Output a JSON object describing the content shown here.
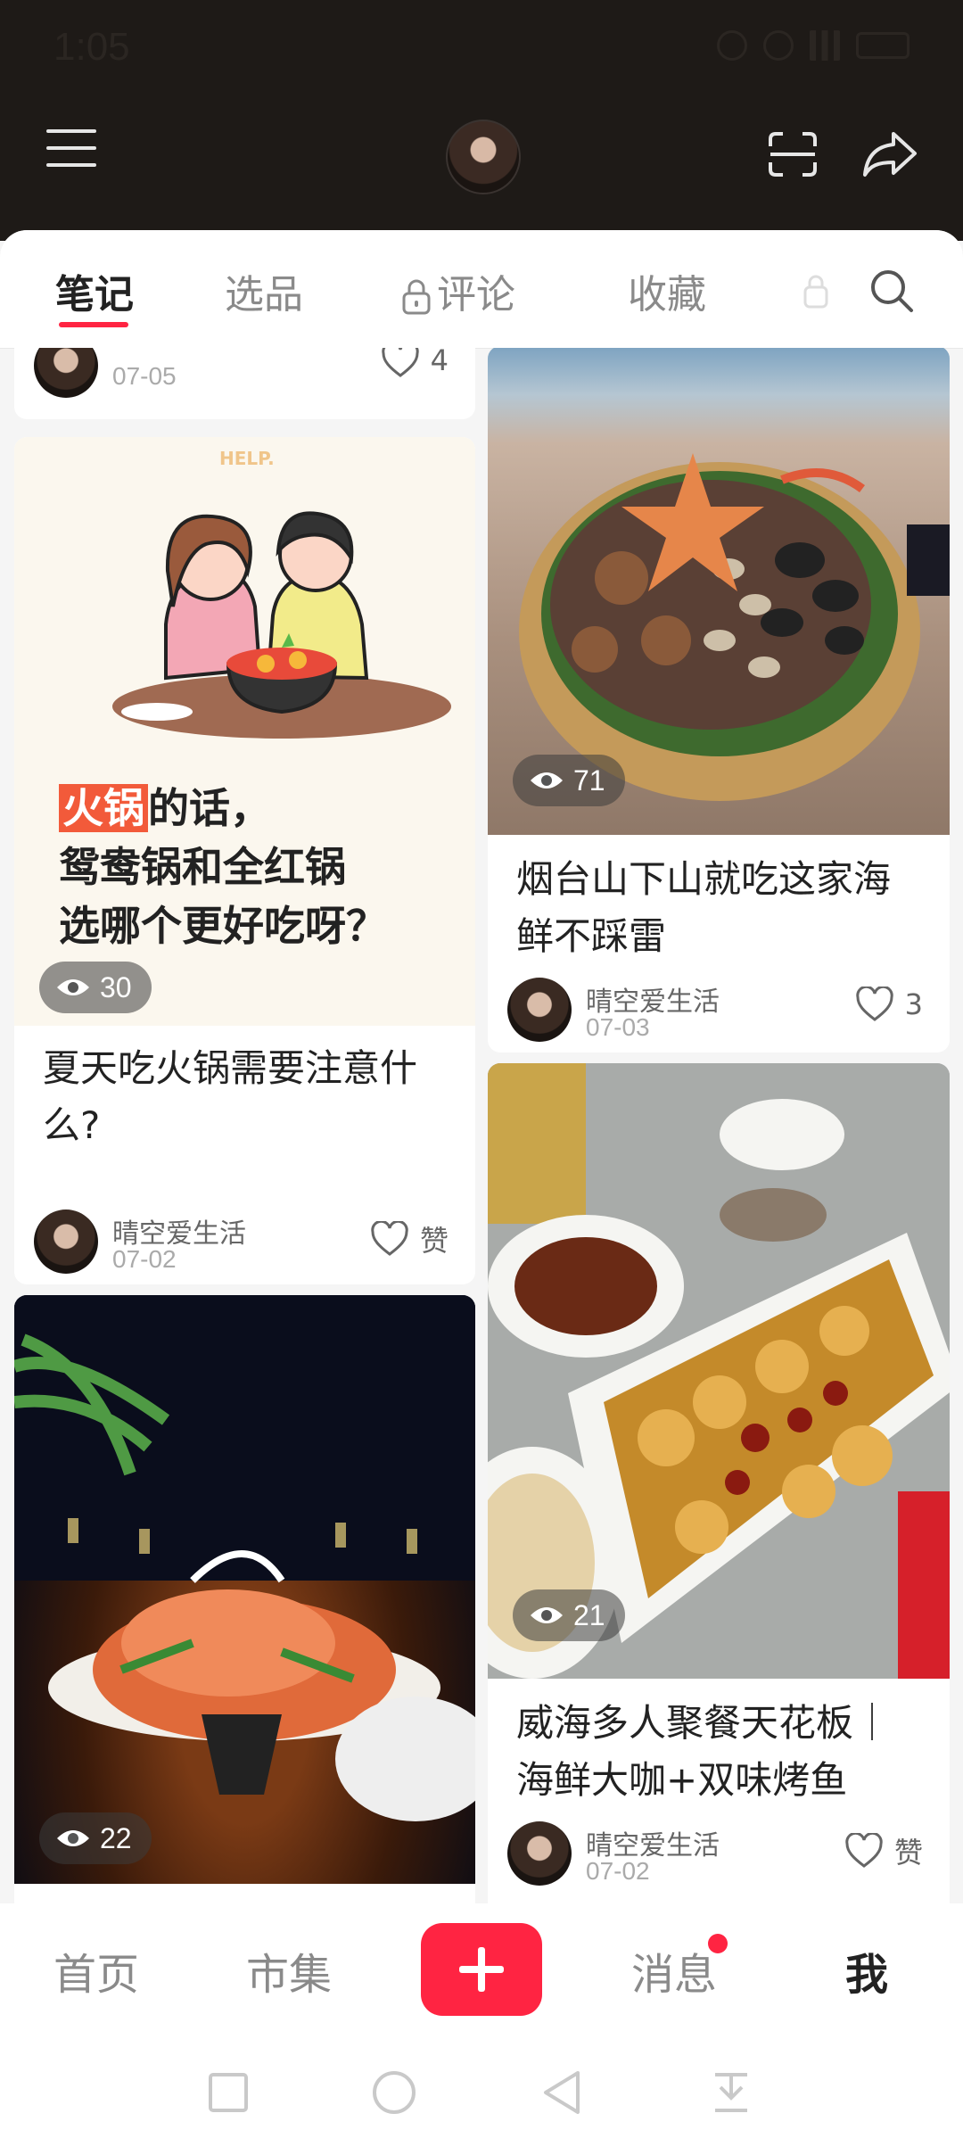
{
  "status_bar": {
    "time": "1:05"
  },
  "tabs": [
    {
      "label": "笔记",
      "active": true
    },
    {
      "label": "选品"
    },
    {
      "label": "评论",
      "locked": true
    },
    {
      "label": "收藏"
    }
  ],
  "colors": {
    "accent": "#ff2442",
    "header_bg": "#1e1a17"
  },
  "feed": {
    "top_partial": {
      "author": "晴空爱生活",
      "date": "07-05",
      "likes": "4"
    },
    "card1": {
      "overlay_lines": [
        "火锅的话，",
        "鸳鸯锅和全红锅",
        "选哪个更好吃呀？"
      ],
      "overlay_highlight": "火锅",
      "overlay_hint": "HELP.",
      "views": "30",
      "title": "夏天吃火锅需要注意什么?",
      "author": "晴空爱生活",
      "date": "07-02",
      "likes": "赞"
    },
    "card2": {
      "views": "71",
      "title": "烟台山下山就吃这家海鲜不踩雷",
      "author": "晴空爱生活",
      "date": "07-03",
      "likes": "3"
    },
    "card3": {
      "views": "22"
    },
    "card4": {
      "views": "21",
      "title": "威海多人聚餐天花板｜海鲜大咖+双味烤鱼",
      "author": "晴空爱生活",
      "date": "07-02",
      "likes": "赞"
    }
  },
  "bottom_nav": {
    "home": "首页",
    "market": "市集",
    "messages": "消息",
    "me": "我"
  }
}
